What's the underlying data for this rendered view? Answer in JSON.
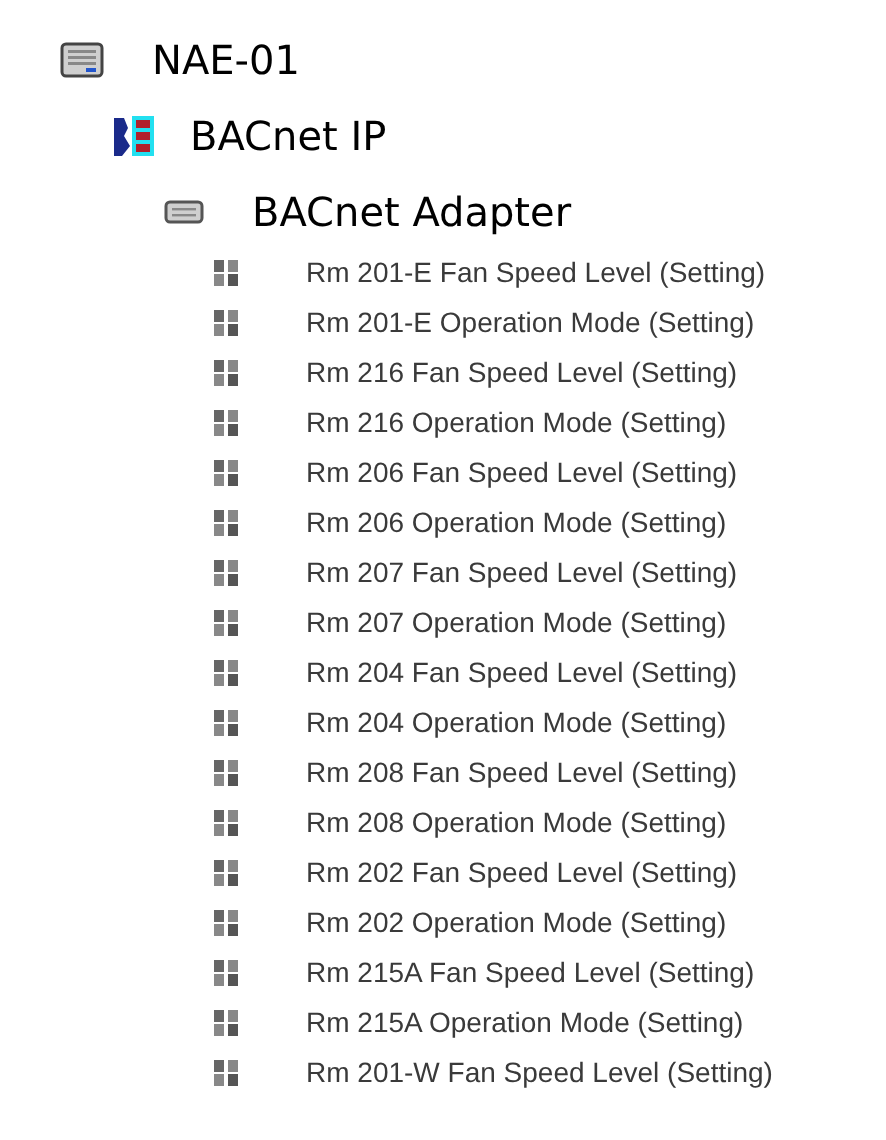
{
  "tree": [
    {
      "kind": "device",
      "label": "NAE-01",
      "children": [
        {
          "kind": "network",
          "label": "BACnet IP",
          "children": [
            {
              "kind": "adapter",
              "label": "BACnet Adapter",
              "children": [
                {
                  "kind": "point",
                  "label": "Rm 201-E Fan Speed Level (Setting)"
                },
                {
                  "kind": "point",
                  "label": "Rm 201-E Operation Mode (Setting)"
                },
                {
                  "kind": "point",
                  "label": "Rm 216 Fan Speed Level (Setting)"
                },
                {
                  "kind": "point",
                  "label": "Rm 216 Operation Mode (Setting)"
                },
                {
                  "kind": "point",
                  "label": "Rm 206 Fan Speed Level (Setting)"
                },
                {
                  "kind": "point",
                  "label": "Rm 206 Operation Mode (Setting)"
                },
                {
                  "kind": "point",
                  "label": "Rm 207 Fan Speed Level (Setting)"
                },
                {
                  "kind": "point",
                  "label": "Rm 207 Operation Mode (Setting)"
                },
                {
                  "kind": "point",
                  "label": "Rm 204 Fan Speed Level (Setting)"
                },
                {
                  "kind": "point",
                  "label": "Rm 204 Operation Mode (Setting)"
                },
                {
                  "kind": "point",
                  "label": "Rm 208 Fan Speed Level (Setting)"
                },
                {
                  "kind": "point",
                  "label": "Rm 208 Operation Mode (Setting)"
                },
                {
                  "kind": "point",
                  "label": "Rm 202 Fan Speed Level (Setting)"
                },
                {
                  "kind": "point",
                  "label": "Rm 202 Operation Mode (Setting)"
                },
                {
                  "kind": "point",
                  "label": "Rm 215A Fan Speed Level (Setting)"
                },
                {
                  "kind": "point",
                  "label": "Rm 215A Operation Mode (Setting)"
                },
                {
                  "kind": "point",
                  "label": "Rm 201-W Fan Speed Level (Setting)"
                }
              ]
            }
          ]
        }
      ]
    }
  ]
}
